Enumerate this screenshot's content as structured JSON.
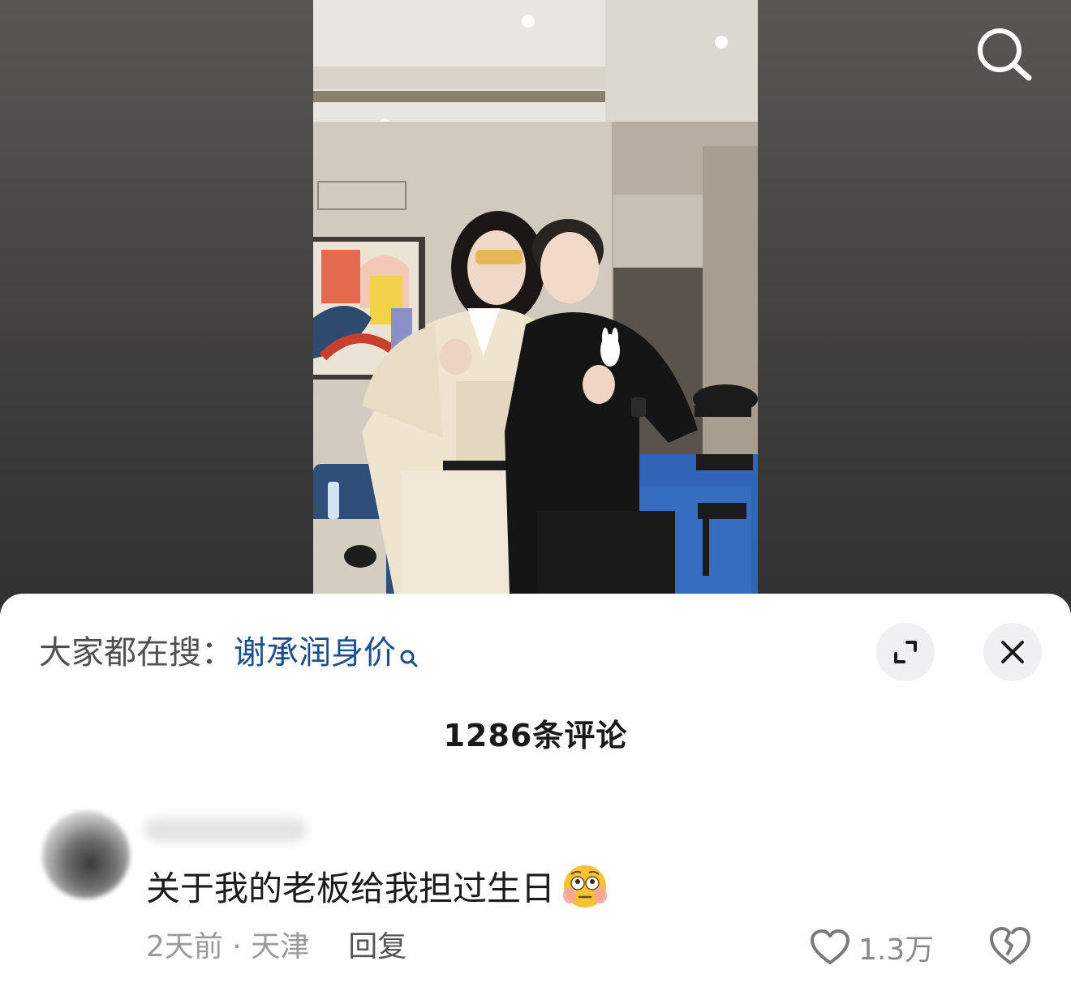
{
  "top_bar": {
    "search_icon": "search-icon"
  },
  "hot_search": {
    "prefix": "大家都在搜：",
    "query": "谢承润身价",
    "icon": "mini-search-icon"
  },
  "sheet": {
    "comment_count": "1286条评论",
    "expand_icon": "expand-icon",
    "close_icon": "close-icon"
  },
  "comment": {
    "text": "关于我的老板给我担过生日",
    "emoji": "flushed-face-emoji",
    "time": "2天前",
    "separator": " · ",
    "location": "天津",
    "reply_label": "回复",
    "like_count": "1.3万",
    "like_icon": "heart-icon",
    "dislike_icon": "broken-heart-icon"
  },
  "colors": {
    "link": "#1e4f8c",
    "meta": "#9b9b9b",
    "sheet_bg": "#ffffff",
    "button_bg": "#f0f0f2"
  }
}
